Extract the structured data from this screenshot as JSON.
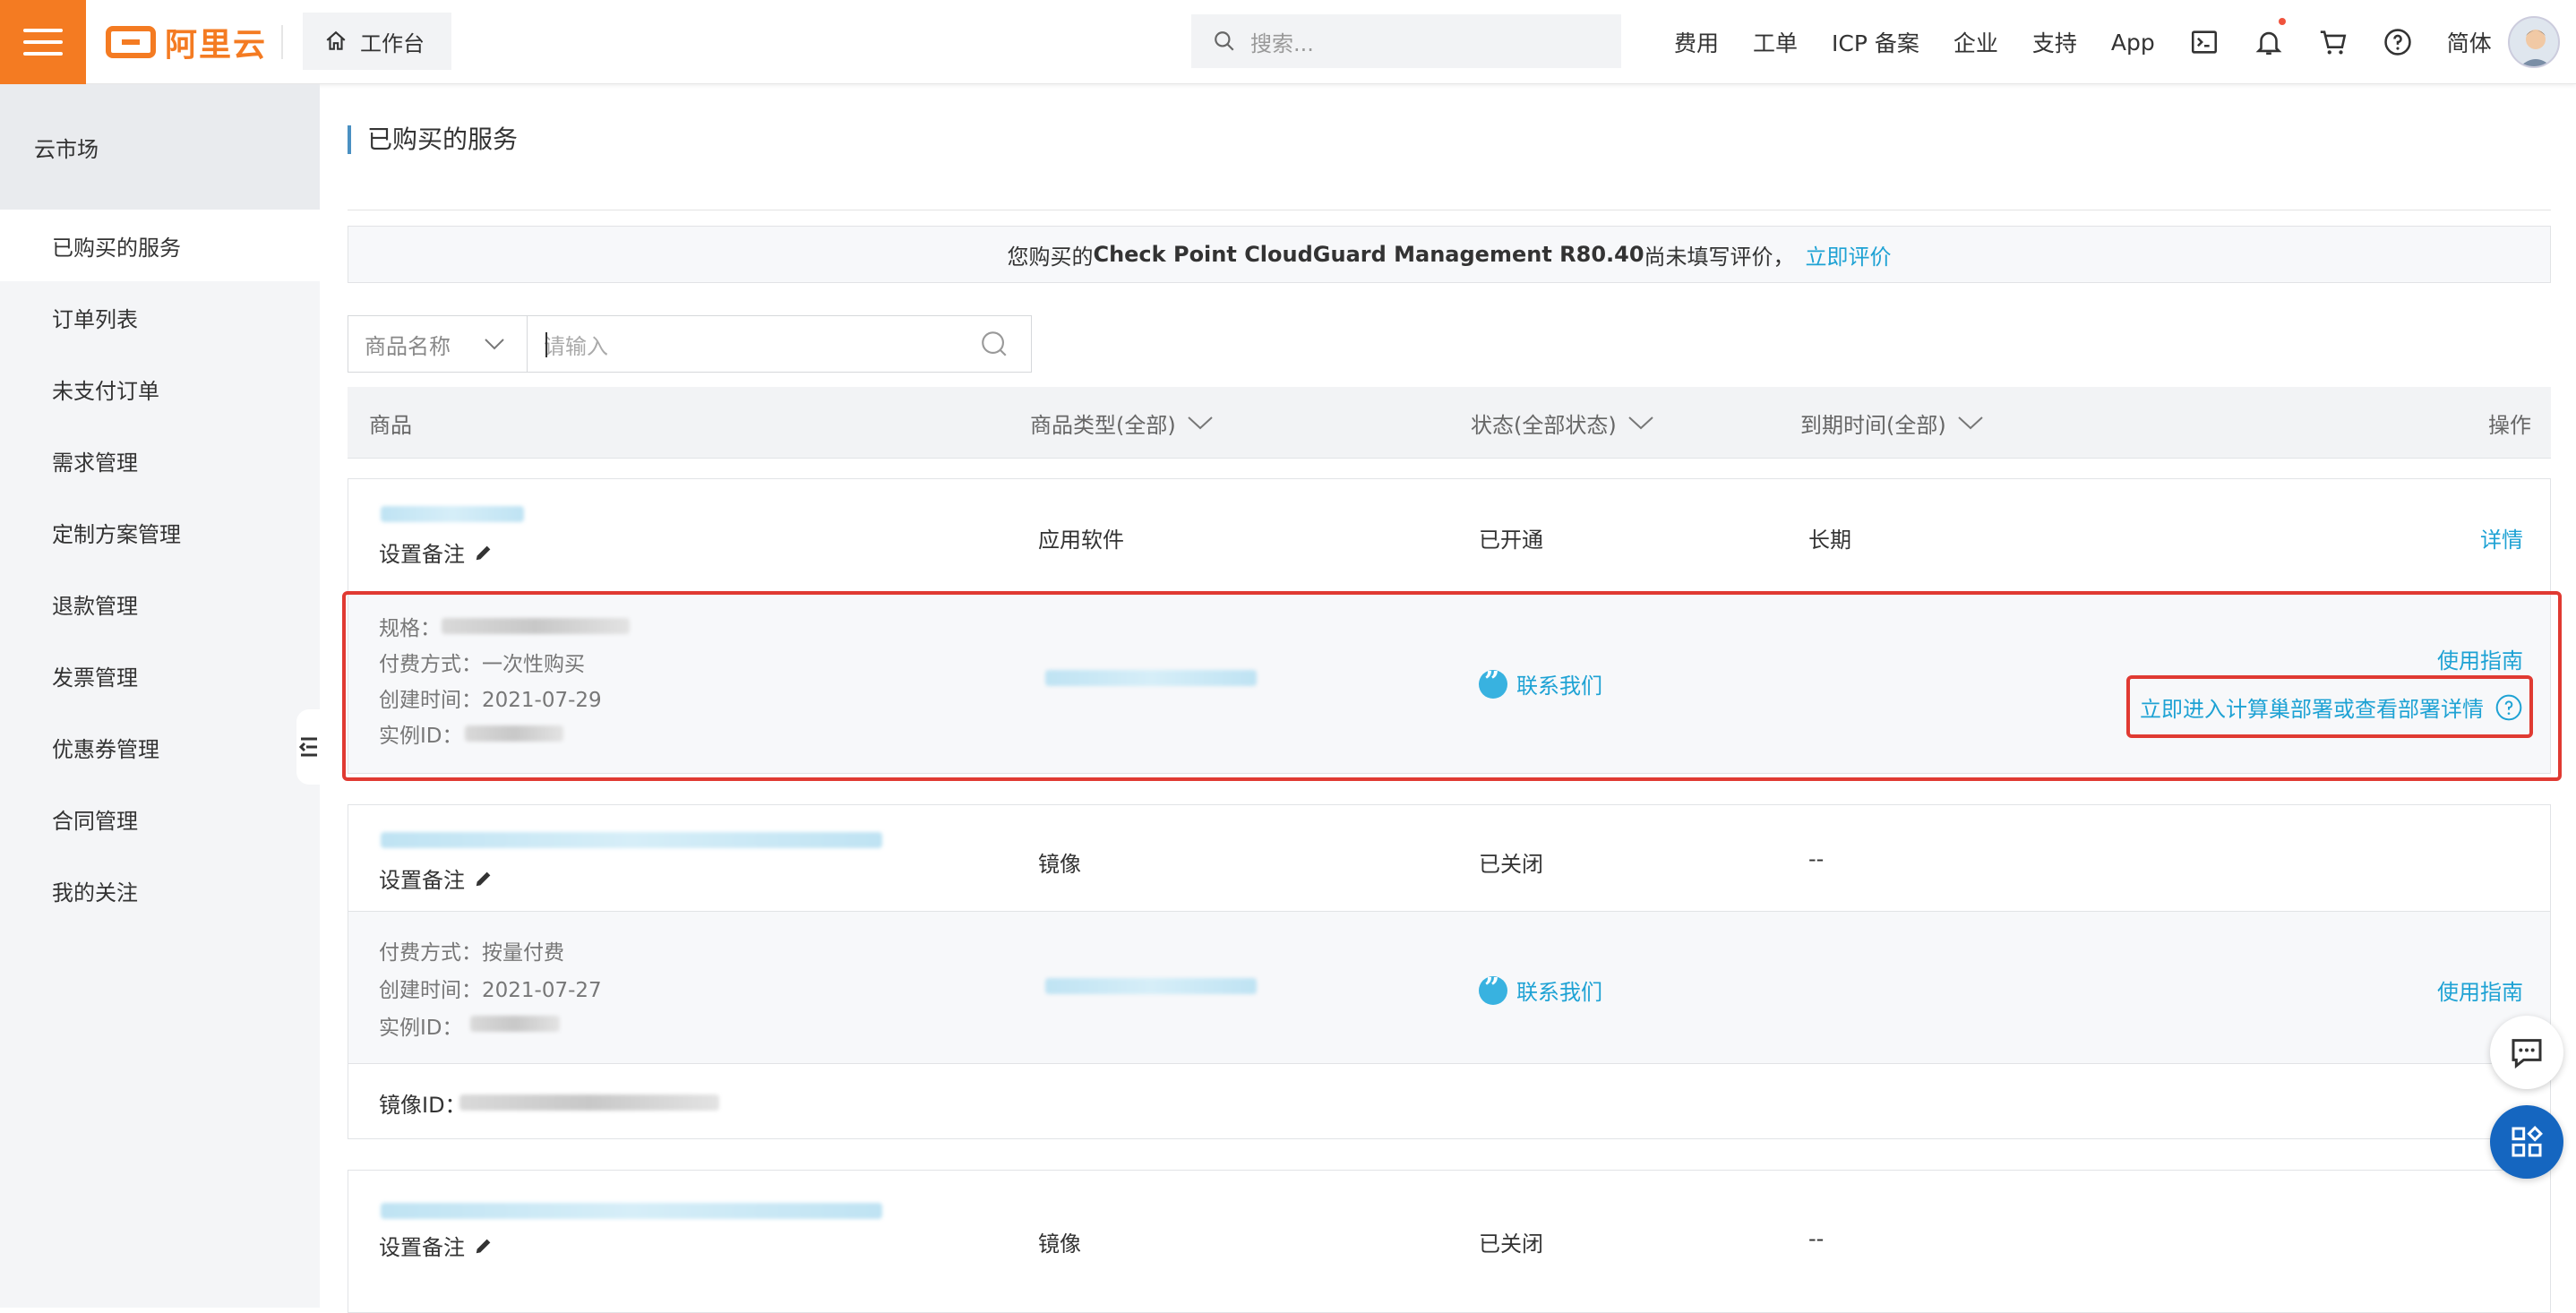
{
  "topbar": {
    "logo_text": "阿里云",
    "workbench_label": "工作台",
    "search_placeholder": "搜索...",
    "nav": [
      "费用",
      "工单",
      "ICP 备案",
      "企业",
      "支持",
      "App"
    ],
    "lang": "简体"
  },
  "sidebar": {
    "title": "云市场",
    "items": [
      "已购买的服务",
      "订单列表",
      "未支付订单",
      "需求管理",
      "定制方案管理",
      "退款管理",
      "发票管理",
      "优惠券管理",
      "合同管理",
      "我的关注"
    ]
  },
  "main": {
    "page_title": "已购买的服务",
    "notice": {
      "prefix": "您购买的",
      "product": "Check Point CloudGuard Management R80.40",
      "suffix": "尚未填写评价，",
      "link": "立即评价"
    },
    "filter": {
      "select_label": "商品名称",
      "input_placeholder": "请输入"
    },
    "columns": {
      "product": "商品",
      "type": "商品类型(全部)",
      "status": "状态(全部状态)",
      "expiry": "到期时间(全部)",
      "action": "操作"
    },
    "rows": [
      {
        "note_label": "设置备注",
        "type": "应用软件",
        "status": "已开通",
        "expiry": "长期",
        "action": "详情",
        "details": {
          "spec_label": "规格：",
          "pay": "付费方式：一次性购买",
          "created": "创建时间：2021-07-29",
          "instance_label": "实例ID：",
          "contact": "联系我们",
          "guide": "使用指南",
          "deploy": "立即进入计算巢部署或查看部署详情"
        }
      },
      {
        "note_label": "设置备注",
        "type": "镜像",
        "status": "已关闭",
        "expiry": "--",
        "details": {
          "pay": "付费方式：按量付费",
          "created": "创建时间：2021-07-27",
          "instance_label": "实例ID：",
          "contact": "联系我们",
          "guide": "使用指南",
          "image_label": "镜像ID："
        }
      },
      {
        "note_label": "设置备注",
        "type": "镜像",
        "status": "已关闭",
        "expiry": "--"
      }
    ]
  },
  "colors": {
    "brand_orange": "#f47b22",
    "link_blue": "#1ea2d4",
    "highlight_red": "#e03a32",
    "float_blue": "#1566c0"
  }
}
